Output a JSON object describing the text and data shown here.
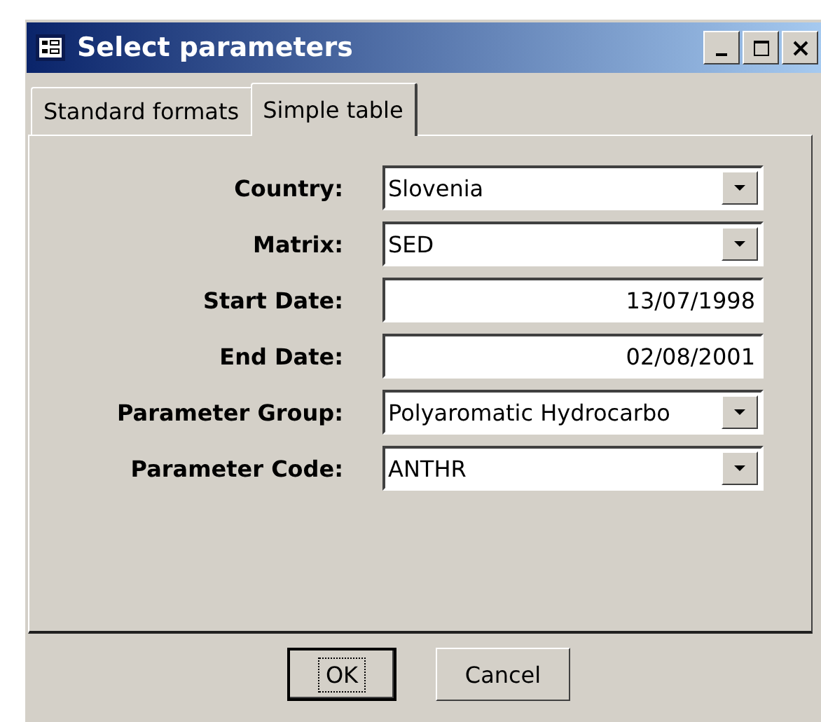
{
  "window": {
    "title": "Select parameters"
  },
  "tabs": [
    {
      "label": "Standard formats",
      "selected": false
    },
    {
      "label": "Simple table",
      "selected": true
    }
  ],
  "fields": [
    {
      "label": "Country:",
      "kind": "combo",
      "value": "Slovenia"
    },
    {
      "label": "Matrix:",
      "kind": "combo",
      "value": "SED"
    },
    {
      "label": "Start Date:",
      "kind": "date",
      "value": "13/07/1998"
    },
    {
      "label": "End Date:",
      "kind": "date",
      "value": "02/08/2001"
    },
    {
      "label": "Parameter Group:",
      "kind": "combo",
      "value": "Polyaromatic Hydrocarbo"
    },
    {
      "label": "Parameter Code:",
      "kind": "combo",
      "value": "ANTHR"
    }
  ],
  "buttons": [
    {
      "label": "OK",
      "default": true
    },
    {
      "label": "Cancel",
      "default": false
    }
  ]
}
